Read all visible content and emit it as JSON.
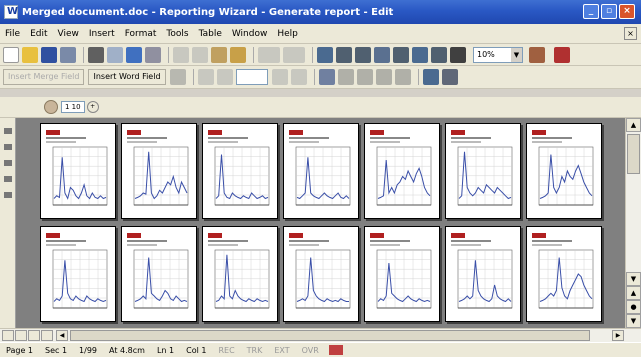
{
  "window": {
    "title": "Merged document.doc - Reporting Wizard - Generate report - Edit",
    "controls": {
      "minimize": "_",
      "restore": "▫",
      "close": "×"
    }
  },
  "menubar": {
    "items": [
      "File",
      "Edit",
      "View",
      "Insert",
      "Format",
      "Tools",
      "Table",
      "Window",
      "Help"
    ]
  },
  "standard_toolbar": {
    "zoom": "10%"
  },
  "mailmerge_toolbar": {
    "insert_merge_field": "Insert Merge Field",
    "insert_word_field": "Insert Word Field"
  },
  "ruler": {
    "zoom_value": "1 10"
  },
  "statusbar": {
    "page": "Page 1",
    "sec": "Sec 1",
    "page_of": "1/99",
    "at": "At 4.8cm",
    "ln": "Ln 1",
    "col": "Col 1",
    "rec": "REC",
    "trk": "TRK",
    "ext": "EXT",
    "ovr": "OVR"
  },
  "colors": {
    "title_bar": "#2a58c4",
    "chrome": "#ece9d8",
    "document_bg": "#808080",
    "chart_line": "#3a4fa8",
    "logo": "#b02020"
  },
  "icons": [
    "new-icon",
    "open-icon",
    "save-icon",
    "print-icon",
    "preview-icon",
    "spelling-icon",
    "cut-icon",
    "copy-icon",
    "paste-icon",
    "undo-icon",
    "redo-icon",
    "table-icon",
    "columns-icon",
    "drawing-icon",
    "show-hide-icon",
    "help-icon"
  ],
  "thumbnail_pages": [
    {
      "series": [
        0.1,
        0.15,
        0.12,
        0.85,
        0.2,
        0.1,
        0.3,
        0.25,
        0.15,
        0.1,
        0.2,
        0.35,
        0.15,
        0.1,
        0.2,
        0.12,
        0.1,
        0.15,
        0.1,
        0.12
      ]
    },
    {
      "series": [
        0.1,
        0.12,
        0.15,
        0.2,
        0.18,
        0.95,
        0.2,
        0.1,
        0.15,
        0.25,
        0.2,
        0.3,
        0.4,
        0.35,
        0.5,
        0.3,
        0.2,
        0.4,
        0.3,
        0.2
      ]
    },
    {
      "series": [
        0.1,
        0.15,
        0.9,
        0.2,
        0.12,
        0.1,
        0.2,
        0.15,
        0.12,
        0.1,
        0.15,
        0.12,
        0.1,
        0.2,
        0.15,
        0.1,
        0.12,
        0.15,
        0.1,
        0.12
      ]
    },
    {
      "series": [
        0.12,
        0.1,
        0.15,
        0.2,
        0.85,
        0.2,
        0.15,
        0.12,
        0.1,
        0.15,
        0.2,
        0.15,
        0.12,
        0.1,
        0.15,
        0.2,
        0.12,
        0.1,
        0.15,
        0.1
      ]
    },
    {
      "series": [
        0.1,
        0.12,
        0.15,
        0.8,
        0.2,
        0.3,
        0.2,
        0.35,
        0.4,
        0.5,
        0.45,
        0.6,
        0.5,
        0.4,
        0.55,
        0.65,
        0.5,
        0.3,
        0.2,
        0.15
      ]
    },
    {
      "series": [
        0.1,
        0.15,
        0.95,
        0.3,
        0.2,
        0.15,
        0.2,
        0.3,
        0.25,
        0.2,
        0.35,
        0.3,
        0.25,
        0.2,
        0.3,
        0.25,
        0.2,
        0.15,
        0.1,
        0.12
      ]
    },
    {
      "series": [
        0.1,
        0.12,
        0.15,
        0.2,
        0.9,
        0.3,
        0.2,
        0.3,
        0.5,
        0.4,
        0.6,
        0.5,
        0.45,
        0.6,
        0.7,
        0.55,
        0.4,
        0.3,
        0.2,
        0.15
      ]
    },
    {
      "series": [
        0.1,
        0.15,
        0.12,
        0.2,
        0.85,
        0.25,
        0.15,
        0.12,
        0.2,
        0.15,
        0.12,
        0.1,
        0.2,
        0.15,
        0.12,
        0.1,
        0.15,
        0.12,
        0.1,
        0.12
      ]
    },
    {
      "series": [
        0.1,
        0.12,
        0.15,
        0.2,
        0.15,
        0.9,
        0.25,
        0.2,
        0.15,
        0.12,
        0.2,
        0.3,
        0.25,
        0.15,
        0.12,
        0.2,
        0.15,
        0.1,
        0.12,
        0.1
      ]
    },
    {
      "series": [
        0.1,
        0.12,
        0.2,
        0.15,
        0.95,
        0.2,
        0.15,
        0.3,
        0.2,
        0.15,
        0.12,
        0.1,
        0.15,
        0.12,
        0.1,
        0.15,
        0.12,
        0.1,
        0.12,
        0.1
      ]
    },
    {
      "series": [
        0.1,
        0.12,
        0.15,
        0.12,
        0.2,
        0.9,
        0.3,
        0.2,
        0.15,
        0.12,
        0.1,
        0.15,
        0.12,
        0.1,
        0.12,
        0.1,
        0.15,
        0.12,
        0.1,
        0.1
      ]
    },
    {
      "series": [
        0.1,
        0.15,
        0.12,
        0.2,
        0.8,
        0.25,
        0.2,
        0.15,
        0.12,
        0.1,
        0.15,
        0.2,
        0.15,
        0.12,
        0.1,
        0.15,
        0.12,
        0.1,
        0.12,
        0.1
      ]
    },
    {
      "series": [
        0.1,
        0.12,
        0.15,
        0.2,
        0.15,
        0.2,
        0.85,
        0.3,
        0.2,
        0.15,
        0.12,
        0.1,
        0.15,
        0.4,
        0.2,
        0.15,
        0.12,
        0.1,
        0.15,
        0.1
      ]
    },
    {
      "series": [
        0.1,
        0.12,
        0.15,
        0.2,
        0.25,
        0.2,
        0.3,
        0.9,
        0.35,
        0.2,
        0.15,
        0.3,
        0.4,
        0.5,
        0.6,
        0.55,
        0.4,
        0.3,
        0.2,
        0.15
      ]
    }
  ]
}
